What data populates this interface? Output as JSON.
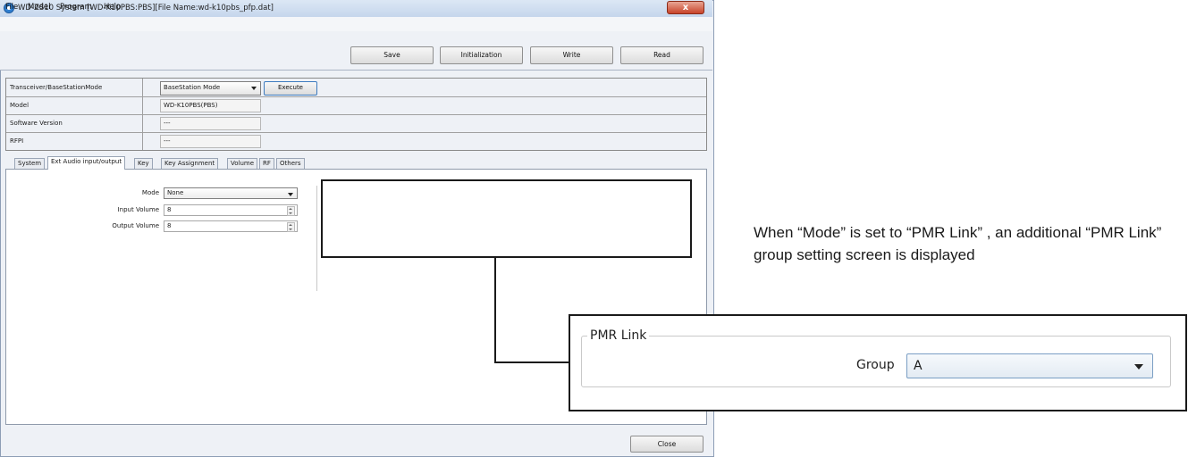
{
  "window": {
    "title": "WD-ZS10 System [WD-K10PBS:PBS][File Name:wd-k10pbs_pfp.dat]",
    "close_glyph": "x"
  },
  "menu": [
    "File",
    "Model",
    "Program",
    "Help"
  ],
  "toolbar": {
    "save": "Save",
    "initialization": "Initialization",
    "write": "Write",
    "read": "Read"
  },
  "info": {
    "mode_label": "Transceiver/BaseStationMode",
    "mode_value": "BaseStation Mode",
    "execute": "Execute",
    "model_label": "Model",
    "model_value": "WD-K10PBS(PBS)",
    "software_label": "Software Version",
    "software_value": "---",
    "rfpi_label": "RFPI",
    "rfpi_value": "---"
  },
  "tabs": [
    "System",
    "Ext Audio input/output",
    "Key",
    "Key Assignment",
    "Volume",
    "RF",
    "Others"
  ],
  "active_tab": "Ext Audio input/output",
  "form": {
    "mode_label": "Mode",
    "mode_value": "None",
    "input_volume_label": "Input Volume",
    "input_volume_value": "8",
    "output_volume_label": "Output Volume",
    "output_volume_value": "8"
  },
  "footer": {
    "close": "Close"
  },
  "annotation": {
    "note": "When “Mode” is set to “PMR Link” , an additional “PMR Link” group setting screen is displayed",
    "group_title": "PMR Link",
    "group_label": "Group",
    "group_value": "A"
  }
}
